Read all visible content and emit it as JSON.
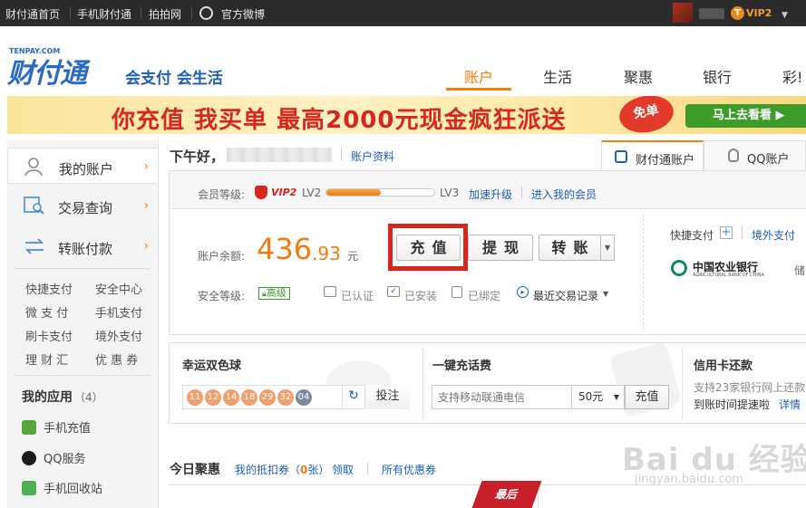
{
  "topbar": {
    "home": "财付通首页",
    "mobile": "手机财付通",
    "paipai": "拍拍网",
    "weibo": "官方微博",
    "vip": "VIP2"
  },
  "header": {
    "logo_small": "TENPAY.COM",
    "logo": "财付通",
    "slogan": "会支付 会生活",
    "nav": [
      "账户",
      "生活",
      "聚惠",
      "银行",
      "彩!"
    ]
  },
  "banner": {
    "text": "你充值 我买单  最高2000元现金疯狂派送",
    "badge": "免单",
    "button": "马上去看看 ▶"
  },
  "sidebar": {
    "main": [
      "我的账户",
      "交易查询",
      "转账付款"
    ],
    "sub": [
      [
        "快捷支付",
        "安全中心"
      ],
      [
        "微 支 付",
        "手机支付"
      ],
      [
        "刷卡支付",
        "境外支付"
      ],
      [
        "理 财 汇",
        "优 惠 券"
      ]
    ],
    "apps_title": "我的应用",
    "apps_count": "（4）",
    "apps": [
      "手机充值",
      "QQ服务",
      "手机回收站"
    ]
  },
  "greeting": {
    "text": "下午好，",
    "profile_link": "账户资料"
  },
  "tabs": {
    "tenpay": "财付通账户",
    "qq": "QQ账户"
  },
  "member": {
    "label": "会员等级:",
    "vip": "VIP2",
    "lv_from": "LV2",
    "lv_to": "LV3",
    "progress": 0.5,
    "upgrade": "加速升级",
    "enter": "进入我的会员"
  },
  "balance": {
    "label": "账户余额:",
    "int": "436",
    "dec": ".93",
    "unit": "元"
  },
  "actions": {
    "recharge": "充值",
    "withdraw": "提现",
    "transfer": "转账"
  },
  "security": {
    "label": "安全等级:",
    "level": "高级",
    "verified": "已认证",
    "installed": "已安装",
    "bound": "已绑定",
    "recent": "最近交易记录"
  },
  "quickpay": {
    "label": "快捷支付",
    "overseas": "境外支付",
    "bank": "中国农业银行",
    "bank_en": "AGRICULTURAL BANK OF CHINA",
    "more": "储"
  },
  "lottery": {
    "title": "幸运双色球",
    "balls": [
      "11",
      "12",
      "14",
      "18",
      "29",
      "32",
      "04"
    ],
    "bet": "投注"
  },
  "phone": {
    "title": "一键充话费",
    "placeholder": "支持移动联通电信",
    "amount": "50元",
    "button": "充值"
  },
  "credit": {
    "title": "信用卡还款",
    "line1": "支持23家银行网上还款",
    "line2": "到账时间提速啦",
    "detail": "详情"
  },
  "deals": {
    "title": "今日聚惠",
    "coupon_prefix": "我的抵扣券（",
    "coupon_count": "0",
    "coupon_suffix": "张）",
    "claim": "领取",
    "all": "所有优惠券",
    "ribbon": "最后"
  },
  "watermark": {
    "brand": "Bai du 经验",
    "url": "jingyan.baidu.com"
  },
  "colors": {
    "accent": "#f27d0f",
    "link": "#1d5fb4",
    "highlight": "#d9261c"
  }
}
